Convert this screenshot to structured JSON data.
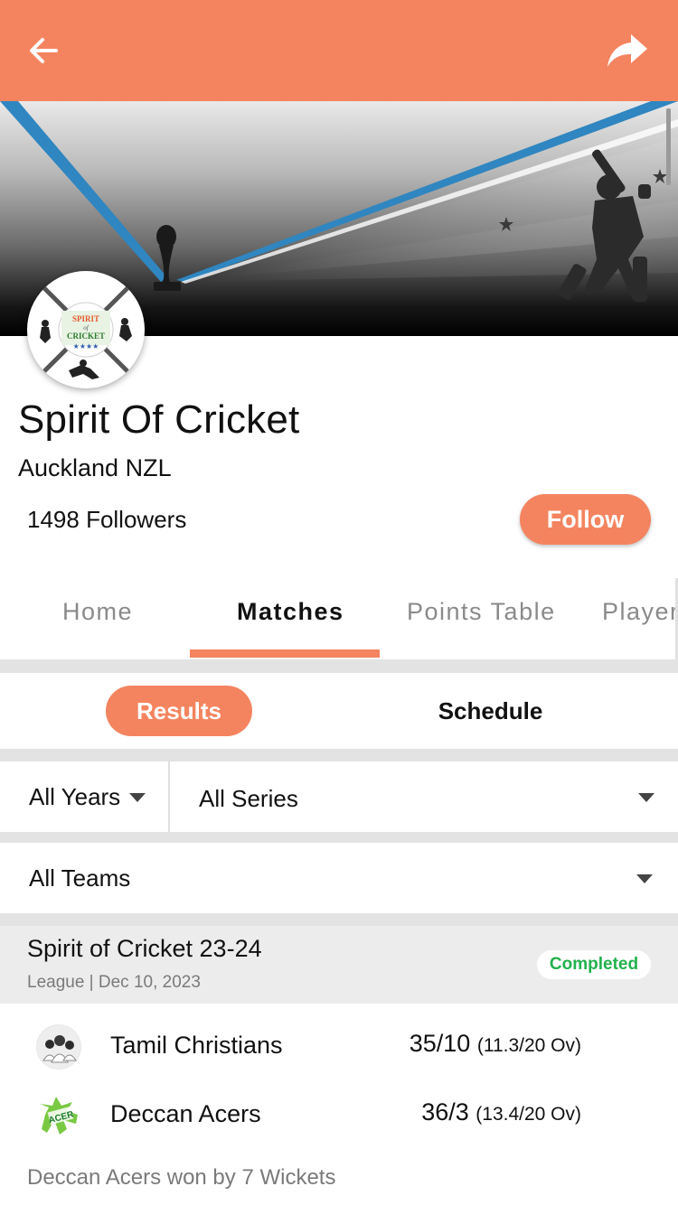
{
  "colors": {
    "accent": "#F4845F",
    "completed_green": "#22b14c"
  },
  "header": {
    "back_icon": "arrow-left-icon",
    "share_icon": "share-icon"
  },
  "club": {
    "name": "Spirit Of Cricket",
    "location": "Auckland NZL",
    "followers": "1498 Followers",
    "follow_label": "Follow",
    "logo_text_top": "SPIRIT",
    "logo_text_mid": "of",
    "logo_text_bottom": "CRICKET"
  },
  "tabs": [
    {
      "label": "Home",
      "active": false
    },
    {
      "label": "Matches",
      "active": true
    },
    {
      "label": "Points Table",
      "active": false
    },
    {
      "label": "Player",
      "active": false
    }
  ],
  "segments": {
    "results": "Results",
    "schedule": "Schedule",
    "selected": "Results"
  },
  "filters": {
    "years": "All Years",
    "series": "All Series",
    "teams": "All Teams"
  },
  "match": {
    "title": "Spirit of Cricket 23-24",
    "subtitle": "League | Dec 10, 2023",
    "status": "Completed",
    "teams": [
      {
        "name": "Tamil Christians",
        "score": "35/10",
        "overs": "(11.3/20 Ov)"
      },
      {
        "name": "Deccan Acers",
        "score": "36/3",
        "overs": "(13.4/20 Ov)",
        "logo_text": "ACER"
      }
    ],
    "result": "Deccan Acers won by 7 Wickets"
  }
}
